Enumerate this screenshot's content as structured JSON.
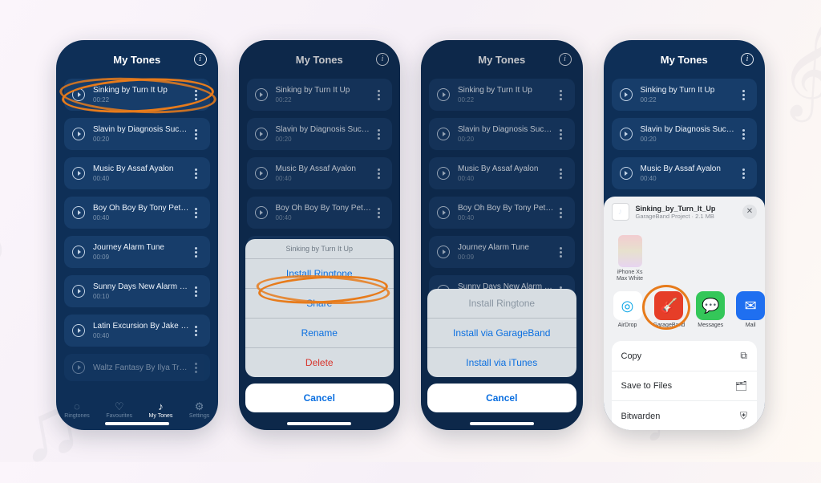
{
  "header": {
    "title": "My Tones"
  },
  "tones": [
    {
      "title": "Sinking by Turn It Up",
      "dur": "00:22"
    },
    {
      "title": "Slavin by Diagnosis Success",
      "dur": "00:20"
    },
    {
      "title": "Music By Assaf Ayalon",
      "dur": "00:40"
    },
    {
      "title": "Boy Oh Boy By Tony Petersen",
      "dur": "00:40"
    },
    {
      "title": "Journey Alarm Tune",
      "dur": "00:09"
    },
    {
      "title": "Sunny Days New Alarm Sou...",
      "dur": "00:10"
    },
    {
      "title": "Latin Excursion By Jake Bra...",
      "dur": "00:40"
    },
    {
      "title": "Waltz Fantasy By Ilya Truhan...",
      "dur": ""
    }
  ],
  "tabs": {
    "ringtones": "Ringtones",
    "favourites": "Favourites",
    "mytones": "My Tones",
    "settings": "Settings"
  },
  "sheet1": {
    "header": "Sinking by Turn It Up",
    "install": "Install Ringtone",
    "share": "Share",
    "rename": "Rename",
    "delete": "Delete",
    "cancel": "Cancel"
  },
  "sheet2": {
    "header": "Install Ringtone",
    "gb": "Install via GarageBand",
    "it": "Install via iTunes",
    "cancel": "Cancel"
  },
  "share": {
    "file": "Sinking_by_Turn_It_Up",
    "meta": "GarageBand Project · 2.1 MB",
    "device": "iPhone Xs Max White",
    "apps": {
      "airdrop": "AirDrop",
      "garage": "GarageBand",
      "messages": "Messages",
      "mail": "Mail"
    },
    "actions": {
      "copy": "Copy",
      "save": "Save to Files",
      "bitwarden": "Bitwarden"
    }
  }
}
